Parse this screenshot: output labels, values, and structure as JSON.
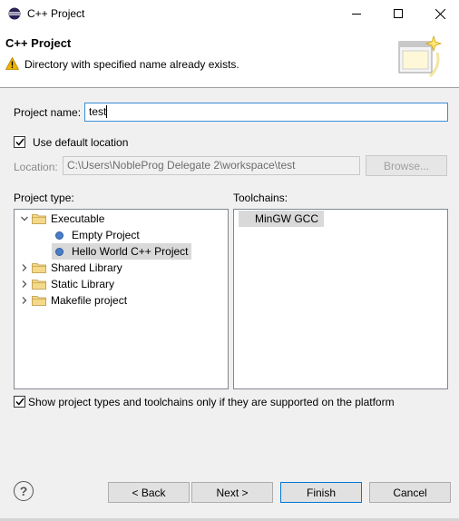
{
  "window": {
    "title": "C++ Project",
    "minimize_icon": "minimize-icon",
    "maximize_icon": "maximize-icon",
    "close_icon": "close-icon"
  },
  "header": {
    "title": "C++ Project",
    "message": "Directory with specified name already exists.",
    "message_icon": "warning-icon"
  },
  "form": {
    "project_name_label": "Project name:",
    "project_name_value": "test",
    "use_default_location_label": "Use default location",
    "use_default_location_checked": true,
    "location_label": "Location:",
    "location_value": "C:\\Users\\NobleProg Delegate 2\\workspace\\test",
    "browse_label": "Browse..."
  },
  "project_type": {
    "label": "Project type:",
    "tree": [
      {
        "label": "Executable",
        "expanded": true,
        "children": [
          {
            "label": "Empty Project"
          },
          {
            "label": "Hello World C++ Project",
            "selected": true
          }
        ]
      },
      {
        "label": "Shared Library",
        "expanded": false
      },
      {
        "label": "Static Library",
        "expanded": false
      },
      {
        "label": "Makefile project",
        "expanded": false
      }
    ]
  },
  "toolchains": {
    "label": "Toolchains:",
    "items": [
      {
        "label": "MinGW GCC",
        "selected": true
      }
    ]
  },
  "filter": {
    "label": "Show project types and toolchains only if they are supported on the platform",
    "checked": true
  },
  "buttons": {
    "help": "?",
    "back": "< Back",
    "next": "Next >",
    "finish": "Finish",
    "cancel": "Cancel"
  },
  "colors": {
    "accent": "#0078d7",
    "warning": "#f0b400",
    "selection": "#d9d9d9"
  }
}
